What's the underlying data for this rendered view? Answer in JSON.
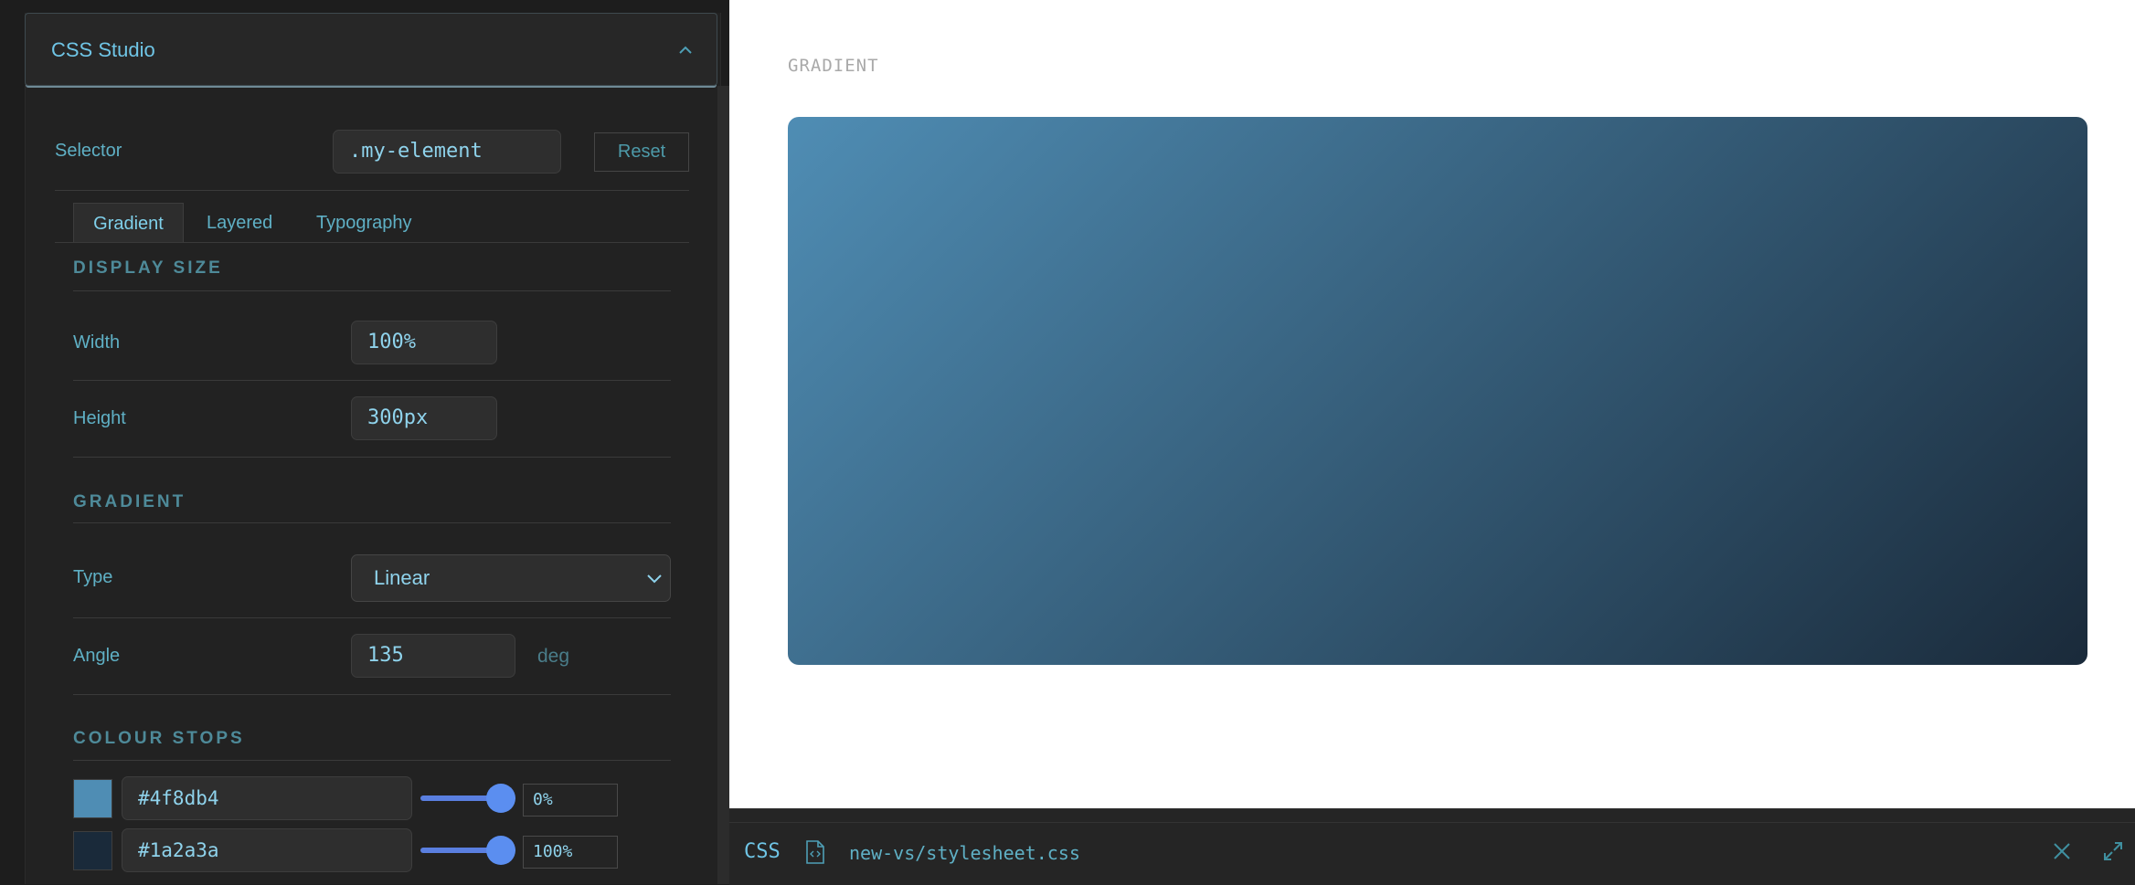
{
  "panel": {
    "title": "CSS Studio",
    "selector_label": "Selector",
    "selector_value": ".my-element",
    "reset_label": "Reset",
    "tabs": [
      {
        "label": "Gradient",
        "active": true
      },
      {
        "label": "Layered",
        "active": false
      },
      {
        "label": "Typography",
        "active": false
      }
    ],
    "display_size": {
      "heading": "DISPLAY SIZE",
      "width_label": "Width",
      "width_value": "100%",
      "height_label": "Height",
      "height_value": "300px"
    },
    "gradient": {
      "heading": "GRADIENT",
      "type_label": "Type",
      "type_value": "Linear",
      "angle_label": "Angle",
      "angle_value": "135",
      "angle_unit": "deg"
    },
    "colour_stops": {
      "heading": "COLOUR STOPS",
      "stops": [
        {
          "color": "#4f8db4",
          "position": "0%"
        },
        {
          "color": "#1a2a3a",
          "position": "100%"
        }
      ]
    }
  },
  "preview": {
    "caption": "GRADIENT",
    "gradient_angle_deg": 135,
    "stop_colors": [
      "#4f8db4",
      "#1a2a3a"
    ]
  },
  "bottom_bar": {
    "label": "CSS",
    "file_path": "new-vs/stylesheet.css"
  },
  "colors": {
    "accent": "#6fc5e6",
    "slider": "#5b8ef0"
  }
}
